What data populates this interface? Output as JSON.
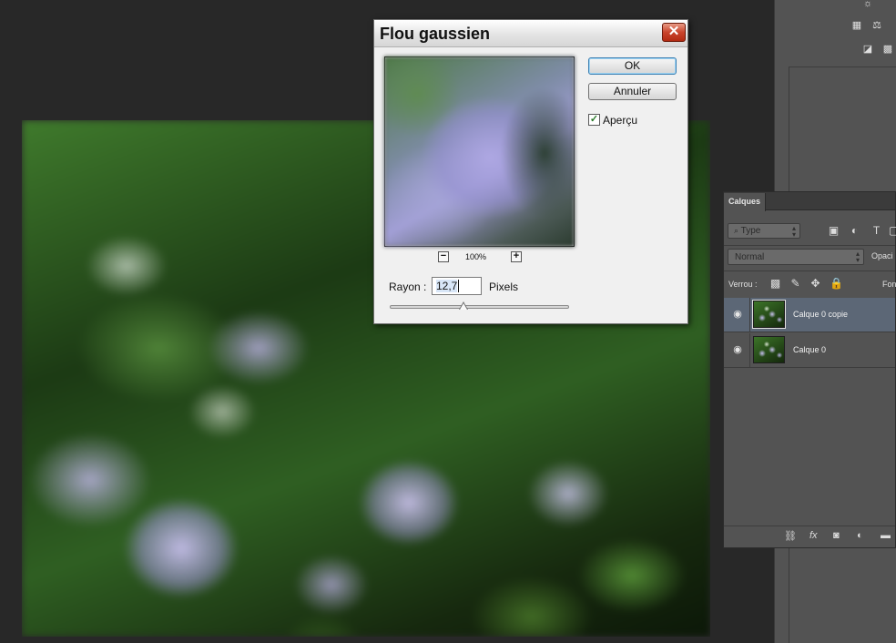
{
  "dialog": {
    "title": "Flou gaussien",
    "ok_label": "OK",
    "cancel_label": "Annuler",
    "preview_label": "Aperçu",
    "preview_checked": true,
    "zoom_level": "100%",
    "zoom_out_symbol": "−",
    "zoom_in_symbol": "+",
    "radius_label": "Rayon :",
    "radius_value": "12,7",
    "radius_unit": "Pixels",
    "radius_slider_fraction": 0.41,
    "close_icon": "close-icon"
  },
  "layers_panel": {
    "tab_label": "Calques",
    "filter_placeholder": "Type",
    "blend_mode": "Normal",
    "opacity_label": "Opaci",
    "lock_label": "Verrou :",
    "fill_label": "Fon",
    "layers": [
      {
        "name": "Calque 0 copie",
        "visible": true,
        "selected": true
      },
      {
        "name": "Calque 0",
        "visible": true,
        "selected": false
      }
    ],
    "bottom_icons": [
      "link-icon",
      "fx-icon",
      "mask-icon",
      "adjustment-icon",
      "group-folder-icon"
    ]
  },
  "colors": {
    "workspace_bg": "#282828",
    "panel_bg": "#535353",
    "selected_layer": "#5c6776",
    "close_button": "#c9442c"
  }
}
